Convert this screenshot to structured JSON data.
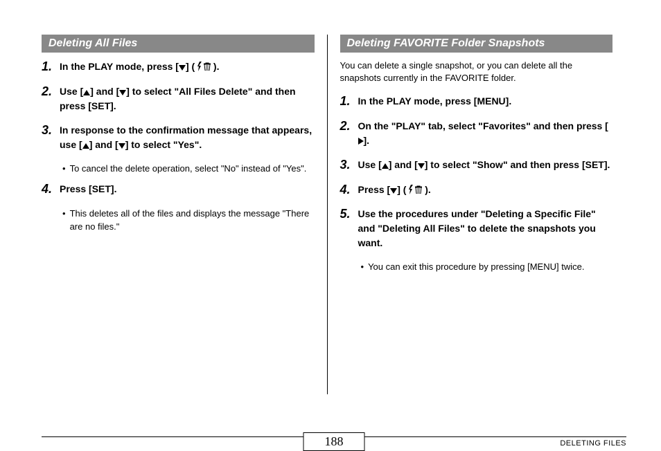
{
  "left": {
    "header": "Deleting All Files",
    "steps": [
      {
        "num": "1.",
        "parts": [
          "In the PLAY mode, press [",
          "down",
          "] ( ",
          "flashtrash",
          " )."
        ]
      },
      {
        "num": "2.",
        "parts": [
          "Use [",
          "up",
          "] and [",
          "down",
          "] to select \"All Files Delete\" and then press [SET]."
        ]
      },
      {
        "num": "3.",
        "parts": [
          "In response to the confirmation message that appears, use [",
          "up",
          "] and [",
          "down",
          "] to select \"Yes\"."
        ]
      },
      {
        "bullet": "To cancel the delete operation, select \"No\" instead of \"Yes\"."
      },
      {
        "num": "4.",
        "parts": [
          "Press [SET]."
        ]
      },
      {
        "bullet": "This deletes all of the files and displays the message \"There are no files.\""
      }
    ]
  },
  "right": {
    "header": "Deleting FAVORITE Folder Snapshots",
    "intro": "You can delete a single snapshot, or you can delete all the snapshots currently in the FAVORITE folder.",
    "steps": [
      {
        "num": "1.",
        "parts": [
          "In the PLAY mode, press [MENU]."
        ]
      },
      {
        "num": "2.",
        "parts": [
          "On the \"PLAY\" tab, select \"Favorites\" and then press [",
          "right",
          "]."
        ]
      },
      {
        "num": "3.",
        "parts": [
          "Use [",
          "up",
          "] and [",
          "down",
          "] to select \"Show\" and then press [SET]."
        ]
      },
      {
        "num": "4.",
        "parts": [
          "Press [",
          "down",
          "] ( ",
          "flashtrash",
          " )."
        ]
      },
      {
        "num": "5.",
        "parts": [
          "Use the procedures under \"Deleting a Specific File\" and \"Deleting All Files\" to delete the snapshots you want."
        ]
      },
      {
        "bullet": "You can exit this procedure by pressing [MENU] twice."
      }
    ]
  },
  "footer": {
    "page": "188",
    "label": "DELETING FILES"
  }
}
